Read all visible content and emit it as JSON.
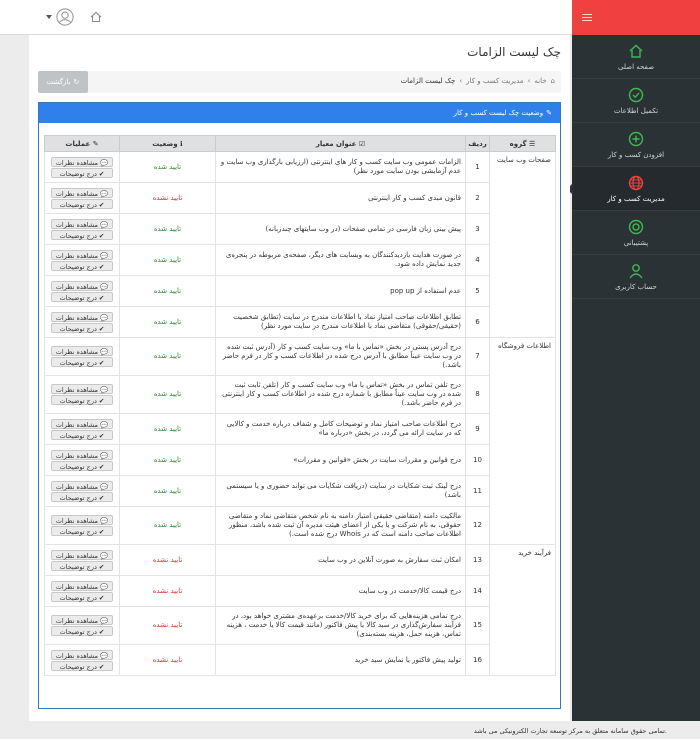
{
  "sidebar": {
    "items": [
      {
        "label": "صفحه اصلی",
        "icon": "home-icon",
        "color": "#3fb950"
      },
      {
        "label": "تکمیل اطلاعات",
        "icon": "check-circle-icon",
        "color": "#3fb950"
      },
      {
        "label": "افزودن کسب و کار",
        "icon": "plus-circle-icon",
        "color": "#3fb950"
      },
      {
        "label": "مدیریت کسب و کار",
        "icon": "globe-icon",
        "color": "#f0403f"
      },
      {
        "label": "پشتیبانی",
        "icon": "support-icon",
        "color": "#3fb950"
      },
      {
        "label": "حساب کاربری",
        "icon": "user-icon",
        "color": "#3fb950"
      }
    ]
  },
  "page": {
    "title": "چک لیست الزامات",
    "breadcrumb": [
      "خانه",
      "مدیریت کسب و کار",
      "چک لیست الزامات"
    ],
    "back_label": "بازگشت"
  },
  "panel": {
    "title": "وضعیت چک لیست کسب و کار"
  },
  "table": {
    "headers": {
      "group": "گروه",
      "row": "ردیف",
      "criterion": "عنوان معیار",
      "status": "وضعیت",
      "ops": "عملیات"
    },
    "view_label": "مشاهده نظرات",
    "note_label": "درج توضیحات",
    "groups": [
      {
        "name": "صفحات وب سایت",
        "rows": [
          {
            "n": "1",
            "text": "الزامات عمومی وب سایت کسب و کار های اینترنتی (ارزیابی بارگذاری وب سایت و عدم آزمایشی بودن سایت مورد نظر)",
            "status": "تایید شده",
            "ok": true
          },
          {
            "n": "2",
            "text": "قانون مبدی کسب و کار اینترنتی",
            "status": "تایید نشده",
            "ok": false
          },
          {
            "n": "3",
            "text": "پیش بینی زبان فارسی در تمامی صفحات (در وب سایتهای چندزبانه)",
            "status": "تایید شده",
            "ok": true
          },
          {
            "n": "4",
            "text": "در صورت هدایت بازدیدکنندگان به وبسایت های دیگر، صفحه‌ی مربوطه در پنجره‌ی جدید نمایش داده شود.",
            "status": "تایید شده",
            "ok": true
          },
          {
            "n": "5",
            "text": "عدم استفاده از pop up",
            "status": "تایید شده",
            "ok": true
          },
          {
            "n": "6",
            "text": "تطابق اطلاعات صاحب امتیاز نماد با اطلاعات مندرج در سایت (تطابق شخصیت (حقیقی/حقوقی) متقاضی نماد با اطلاعات مندرج در سایت مورد نظر)",
            "status": "تایید شده",
            "ok": true
          }
        ]
      },
      {
        "name": "اطلاعات فروشگاه",
        "rows": [
          {
            "n": "7",
            "text": "درج آدرس پستی در بخش «تماس با ما» وب سایت کسب و کار (آدرس ثبت شده در وب سایت عیناً مطابق با آدرس درج شده در اطلاعات کسب و کار در فرم حاضر باشد.)",
            "status": "تایید شده",
            "ok": true
          },
          {
            "n": "8",
            "text": "درج تلفن تماس در بخش «تماس با ما» وب سایت کسب و کار (تلفن ثابت ثبت شده در وب سایت عیناً مطابق با شماره درج شده در اطلاعات کسب و کار اینترنتی در فرم حاضر باشد.)",
            "status": "تایید شده",
            "ok": true
          },
          {
            "n": "9",
            "text": "درج اطلاعات صاحب امتیاز نماد و توضیحات کامل و شفاف درباره خدمت و کالایی که در سایت ارائه می گردد، در بخش «درباره ما»",
            "status": "تایید شده",
            "ok": true
          },
          {
            "n": "10",
            "text": "درج قوانین و مقررات سایت در بخش «قوانین و مقررات»",
            "status": "تایید شده",
            "ok": true
          },
          {
            "n": "11",
            "text": "درج لینک ثبت شکایات در سایت (دریافت شکایات می تواند حضوری و یا سیستمی باشد)",
            "status": "تایید شده",
            "ok": true
          },
          {
            "n": "12",
            "text": "مالکیت دامنه (متقاضی حقیقی امتیاز دامنه به نام شخص متقاضی نماد و متقاضی حقوقی، به نام شرکت و یا یکی از اعضای هیئت مدیره آن ثبت شده باشد، منظور اطلاعات صاحب دامنه است که در Whois درج شده است.)",
            "status": "تایید شده",
            "ok": true
          }
        ]
      },
      {
        "name": "فرآیند خرید",
        "rows": [
          {
            "n": "13",
            "text": "امکان ثبت سفارش به صورت آنلاین در وب سایت",
            "status": "تایید نشده",
            "ok": false
          },
          {
            "n": "14",
            "text": "درج قیمت کالا/خدمت در وب سایت",
            "status": "تایید نشده",
            "ok": false
          },
          {
            "n": "15",
            "text": "درج تمامی هزینه‌هایی که برای خرید کالا/خدمت برعهده‌ی مشتری خواهد بود، در فرآیند سفارش‌گذاری در سبد کالا یا پیش فاکتور (مانند قیمت کالا یا خدمت ، هزینه تماس، هزینه حمل، هزینه بسته‌بندی)",
            "status": "تایید نشده",
            "ok": false
          },
          {
            "n": "16",
            "text": "تولید پیش فاکتور یا نمایش سبد خرید",
            "status": "تایید نشده",
            "ok": false
          }
        ]
      }
    ]
  },
  "footer": {
    "text": "تمامی حقوق سامانه متعلق به مرکز توسعه تجارت الکترونیکی می باشد."
  }
}
